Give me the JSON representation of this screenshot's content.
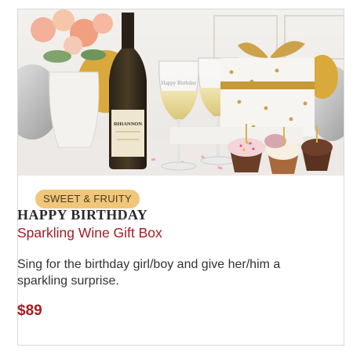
{
  "product_card": {
    "badge": "SWEET & FRUITY",
    "title_line1": "HAPPY BIRTHDAY",
    "title_line2": "Sparkling Wine Gift Box",
    "description": "Sing for the birthday girl/boy and give her/him a sparkling surprise.",
    "price": "$89",
    "image": {
      "bottle_label": "RHIANNON",
      "glass_text": "Happy Birthday"
    }
  },
  "colors": {
    "badge_bg": "#f0c77a",
    "accent_red": "#a51c24",
    "border": "#d9d9d9"
  }
}
